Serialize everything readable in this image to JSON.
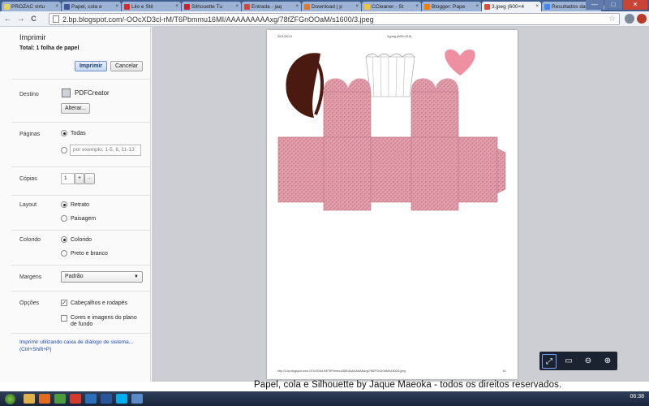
{
  "browser": {
    "tabs": [
      {
        "title": "PROZAC virtu",
        "color": "#e9d35a",
        "active": false
      },
      {
        "title": "Papel, cola e",
        "color": "#3b5998",
        "active": false
      },
      {
        "title": "Lilo e Stit",
        "color": "#d62b2b",
        "active": false
      },
      {
        "title": "Silhouette Tu",
        "color": "#c8232c",
        "active": false
      },
      {
        "title": "Entrada - jaq",
        "color": "#d44638",
        "active": false
      },
      {
        "title": "Download | p",
        "color": "#e07a2a",
        "active": false
      },
      {
        "title": "CCleaner - St",
        "color": "#f3c433",
        "active": false
      },
      {
        "title": "Blogger: Pape",
        "color": "#f57d00",
        "active": false
      },
      {
        "title": "3.jpeg (600×4",
        "color": "#dd4b39",
        "active": true
      },
      {
        "title": "Resultados da",
        "color": "#4285f4",
        "active": false
      }
    ],
    "window_buttons": {
      "minimize": "—",
      "maximize": "□",
      "close": "✕"
    },
    "nav": {
      "back": "←",
      "forward": "→",
      "reload": "C"
    },
    "url": "2.bp.blogspot.com/-OOcXD3cl-rM/T6Pbmmu16MI/AAAAAAAAAxg/78fZFGnOOaM/s1600/3.jpeg",
    "star_icon": "☆"
  },
  "print": {
    "title": "Imprimir",
    "total_label": "Total:",
    "total_value": "1 folha de papel",
    "print_button": "Imprimir",
    "cancel_button": "Cancelar",
    "destination": {
      "label": "Destino",
      "printer": "PDFCreator",
      "change_button": "Alterar..."
    },
    "pages": {
      "label": "Páginas",
      "all": "Todas",
      "placeholder": "por exemplo, 1-5, 8, 11-13"
    },
    "copies": {
      "label": "Cópias",
      "value": "1",
      "plus": "+",
      "minus": "–"
    },
    "layout": {
      "label": "Layout",
      "portrait": "Retrato",
      "landscape": "Paisagem"
    },
    "color": {
      "label": "Colorido",
      "color": "Colorido",
      "bw": "Preto e branco"
    },
    "margins": {
      "label": "Margens",
      "value": "Padrão"
    },
    "options": {
      "label": "Opções",
      "headers": "Cabeçalhos e rodapés",
      "backgrounds": "Cores e imagens do plano de fundo"
    },
    "system_dialog_link": "Imprimir utilizando caixa de diálogo de sistema... (Ctrl+Shift+P)"
  },
  "preview": {
    "header_date": "26/1/2014",
    "header_title": "3.jpeg (600×415)",
    "footer_url": "http://2.bp.blogspot.com/-OOcXD3cl-rM/T6Pbmmu16MI/AAAAAAAAAxg/78fZFGnOOaM/s1600/3.jpeg",
    "footer_page": "1/1",
    "colors": {
      "pink": "#e3a0ac",
      "pink_dark": "#c97b8b",
      "brown": "#4a1a10",
      "heart": "#ee8fa2"
    },
    "zoom_icons": {
      "fit": "fit-page-icon",
      "fit_width": "fit-width-icon",
      "zoom_out": "zoom-out-icon",
      "zoom_in": "zoom-in-icon"
    }
  },
  "watermark": "Papel, cola e Silhouette by Jaque Maeoka - todos os direitos reservados.",
  "taskbar": {
    "apps": [
      {
        "name": "explorer-icon",
        "color": "#e0b04a"
      },
      {
        "name": "firefox-icon",
        "color": "#e36b1f"
      },
      {
        "name": "chrome-icon",
        "color": "#4a9d3e"
      },
      {
        "name": "media-icon",
        "color": "#d33c2c"
      },
      {
        "name": "photoshop-icon",
        "color": "#2a6fb8"
      },
      {
        "name": "word-icon",
        "color": "#2a5699"
      },
      {
        "name": "skype-icon",
        "color": "#00aff0"
      },
      {
        "name": "app-icon",
        "color": "#5a8ac8"
      }
    ],
    "time": "06:38"
  }
}
